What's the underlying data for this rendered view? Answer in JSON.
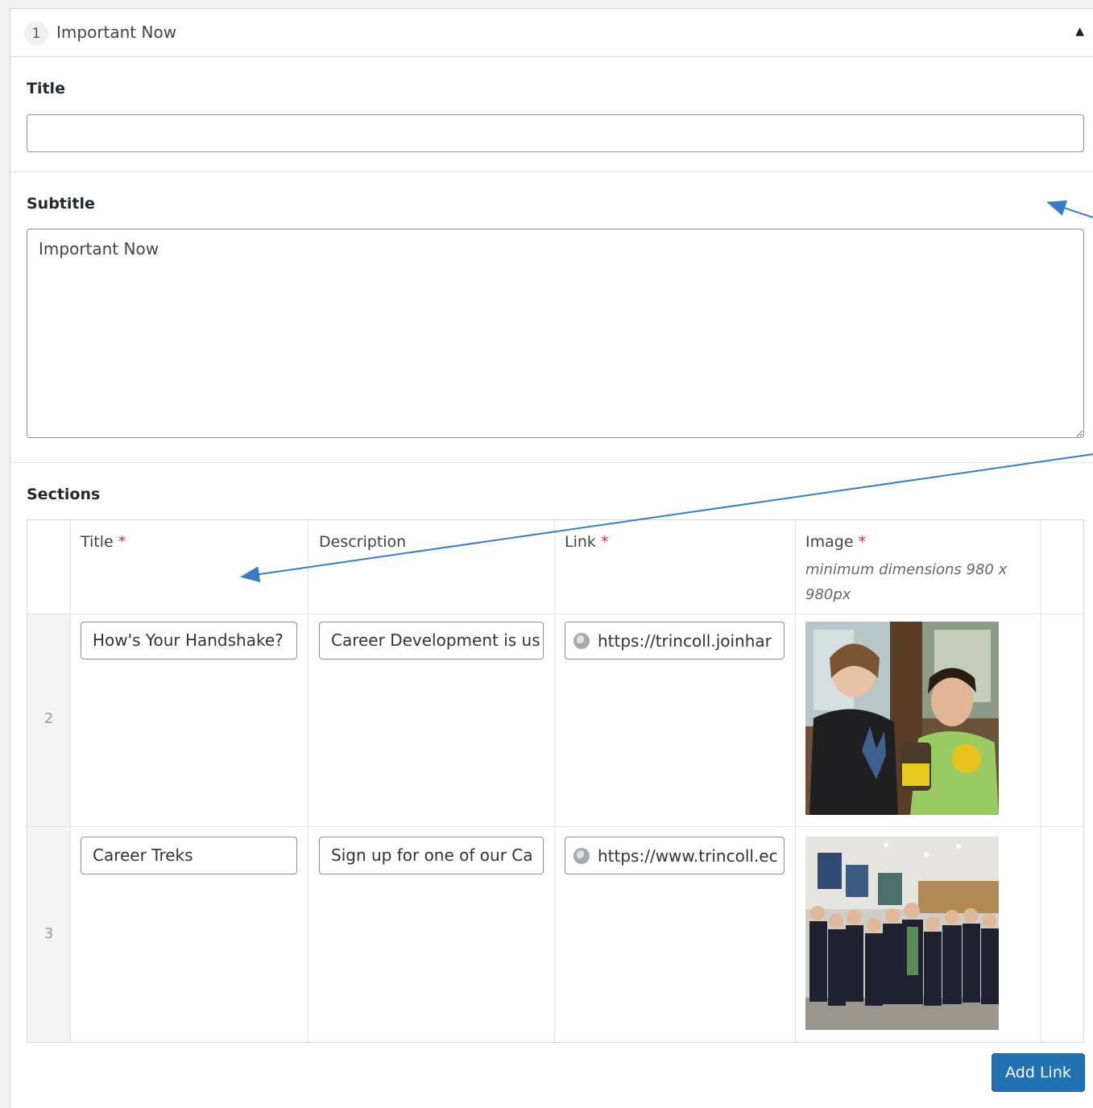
{
  "header": {
    "row_number": "1",
    "title": "Important Now",
    "toggle_glyph": "▲"
  },
  "fields": {
    "title_label": "Title",
    "title_value": "",
    "subtitle_label": "Subtitle",
    "subtitle_value": "Important Now",
    "sections_label": "Sections"
  },
  "table": {
    "columns": {
      "title": "Title",
      "description": "Description",
      "link": "Link",
      "image": "Image",
      "required_mark": "*",
      "image_hint": "minimum dimensions 980 x 980px"
    },
    "rows": [
      {
        "order": "2",
        "title": "How's Your Handshake?",
        "description": "Career Development is us",
        "link": "https://trincoll.joinhar",
        "image_icon": "photo-two-students-holding-cookies"
      },
      {
        "order": "3",
        "title": "Career Treks",
        "description": "Sign up for one of our Ca",
        "link": "https://www.trincoll.ec",
        "image_icon": "photo-group-of-students"
      }
    ]
  },
  "actions": {
    "add_link_label": "Add Link"
  },
  "colors": {
    "primary": "#2271b1",
    "required": "#dc3232",
    "annotation_arrow": "#3a7cc3"
  }
}
